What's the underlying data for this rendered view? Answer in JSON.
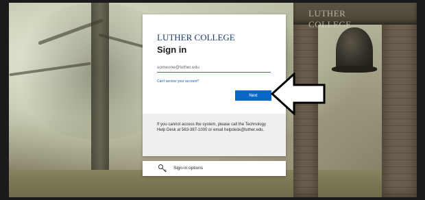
{
  "background": {
    "tower_sign": "LUTHER COLLEGE"
  },
  "login": {
    "logo_text": "LUTHER COLLEGE",
    "title": "Sign in",
    "email_placeholder": "someone@luther.edu",
    "cant_access_link": "Can't access your account?",
    "next_label": "Next",
    "help_text": "If you cannot access the system, please call the Technology Help Desk at 563-387-1000 or email helpdesk@luther.edu."
  },
  "signin_options": {
    "label": "Sign-in options",
    "icon": "key-icon"
  },
  "annotation": {
    "icon": "left-arrow",
    "fill": "#ffffff",
    "stroke": "#000000"
  },
  "colors": {
    "accent": "#0a67c9",
    "logo": "#1f3a6b",
    "link": "#0a5bc4"
  }
}
